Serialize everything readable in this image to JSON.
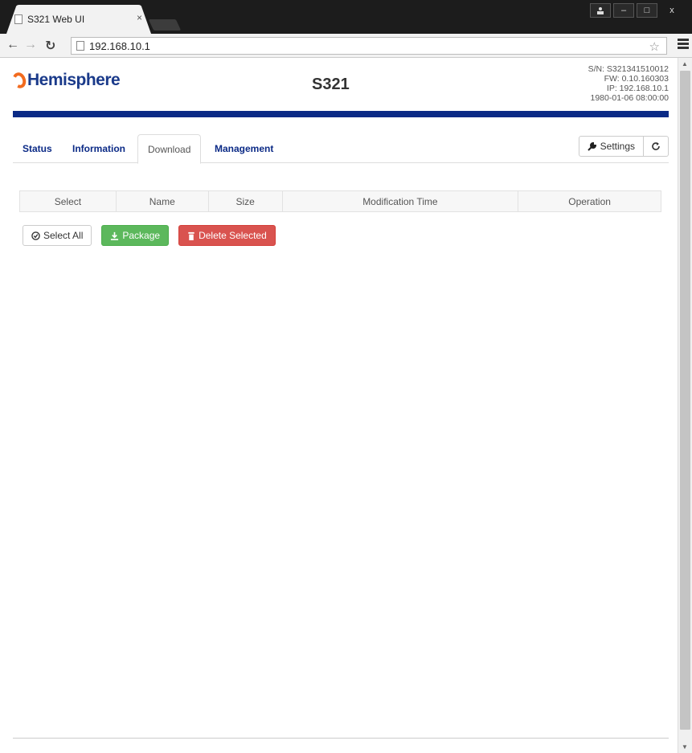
{
  "browser": {
    "tab_title": "S321 Web UI",
    "tab_close": "×",
    "url": "192.168.10.1",
    "window_controls": [
      "–",
      "□",
      "x"
    ]
  },
  "header": {
    "logo_text": "Hemisphere",
    "model": "S321",
    "serial": "S/N: S321341510012",
    "firmware": "FW: 0.10.160303",
    "ip": "IP: 192.168.10.1",
    "datetime": "1980-01-06 08:00:00"
  },
  "nav": {
    "tabs": [
      {
        "label": "Status",
        "active": false
      },
      {
        "label": "Information",
        "active": false
      },
      {
        "label": "Download",
        "active": true
      },
      {
        "label": "Management",
        "active": false
      }
    ],
    "settings_label": "Settings"
  },
  "table": {
    "columns": [
      "Select",
      "Name",
      "Size",
      "Modification Time",
      "Operation"
    ],
    "rows": []
  },
  "actions": {
    "select_all": "Select All",
    "package": "Package",
    "delete_selected": "Delete Selected"
  },
  "colors": {
    "brand_blue": "#0b2a86",
    "brand_orange": "#f26b1f",
    "success": "#5cb85c",
    "danger": "#d9534f"
  }
}
